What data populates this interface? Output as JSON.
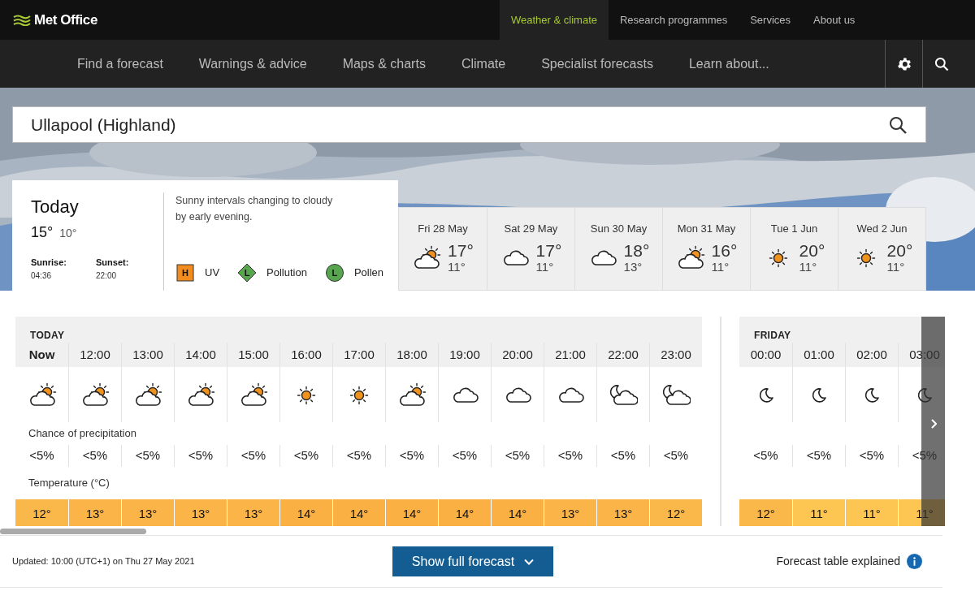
{
  "header": {
    "logo": "Met Office",
    "top_nav": [
      {
        "label": "Weather & climate",
        "selected": true
      },
      {
        "label": "Research programmes",
        "selected": false
      },
      {
        "label": "Services",
        "selected": false
      },
      {
        "label": "About us",
        "selected": false
      }
    ],
    "main_nav": [
      "Find a forecast",
      "Warnings & advice",
      "Maps & charts",
      "Climate",
      "Specialist forecasts",
      "Learn about..."
    ]
  },
  "search": {
    "value": "Ullapool (Highland)"
  },
  "today": {
    "title": "Today",
    "high": "15°",
    "low": "10°",
    "sunrise_label": "Sunrise:",
    "sunrise": "04:36",
    "sunset_label": "Sunset:",
    "sunset": "22:00",
    "summary": "Sunny intervals changing to cloudy by early evening.",
    "indices": [
      {
        "kind": "square",
        "letter": "H",
        "label": "UV",
        "color": "#f28c1e"
      },
      {
        "kind": "diamond",
        "letter": "L",
        "label": "Pollution",
        "color": "#57a64f"
      },
      {
        "kind": "circle",
        "letter": "L",
        "label": "Pollen",
        "color": "#57a64f"
      }
    ]
  },
  "days": [
    {
      "date": "Fri 28 May",
      "kind": "sunny-intervals",
      "high": "17°",
      "low": "11°"
    },
    {
      "date": "Sat 29 May",
      "kind": "cloudy",
      "high": "17°",
      "low": "11°"
    },
    {
      "date": "Sun 30 May",
      "kind": "cloudy",
      "high": "18°",
      "low": "13°"
    },
    {
      "date": "Mon 31 May",
      "kind": "sunny-intervals",
      "high": "16°",
      "low": "11°"
    },
    {
      "date": "Tue 1 Jun",
      "kind": "sunny",
      "high": "20°",
      "low": "11°"
    },
    {
      "date": "Wed 2 Jun",
      "kind": "sunny",
      "high": "20°",
      "low": "11°"
    }
  ],
  "hourly": [
    {
      "day": "TODAY",
      "precip_label": "Chance of precipitation",
      "temp_label": "Temperature (°C)",
      "hours": [
        {
          "time": "Now",
          "current": true,
          "kind": "sunny-intervals",
          "precip": "<5%",
          "temp": "12°",
          "color": "#fbb84a"
        },
        {
          "time": "12:00",
          "current": false,
          "kind": "sunny-intervals",
          "precip": "<5%",
          "temp": "13°",
          "color": "#fbb447"
        },
        {
          "time": "13:00",
          "current": false,
          "kind": "sunny-intervals",
          "precip": "<5%",
          "temp": "13°",
          "color": "#fbb447"
        },
        {
          "time": "14:00",
          "current": false,
          "kind": "sunny-intervals",
          "precip": "<5%",
          "temp": "13°",
          "color": "#fbb447"
        },
        {
          "time": "15:00",
          "current": false,
          "kind": "sunny-intervals",
          "precip": "<5%",
          "temp": "13°",
          "color": "#fbb447"
        },
        {
          "time": "16:00",
          "current": false,
          "kind": "sunny",
          "precip": "<5%",
          "temp": "14°",
          "color": "#fab043"
        },
        {
          "time": "17:00",
          "current": false,
          "kind": "sunny",
          "precip": "<5%",
          "temp": "14°",
          "color": "#fab043"
        },
        {
          "time": "18:00",
          "current": false,
          "kind": "sunny-intervals",
          "precip": "<5%",
          "temp": "14°",
          "color": "#fab043"
        },
        {
          "time": "19:00",
          "current": false,
          "kind": "cloudy",
          "precip": "<5%",
          "temp": "14°",
          "color": "#fab043"
        },
        {
          "time": "20:00",
          "current": false,
          "kind": "cloudy",
          "precip": "<5%",
          "temp": "14°",
          "color": "#fab043"
        },
        {
          "time": "21:00",
          "current": false,
          "kind": "cloudy",
          "precip": "<5%",
          "temp": "13°",
          "color": "#fbb447"
        },
        {
          "time": "22:00",
          "current": false,
          "kind": "partly-cloudy-night",
          "precip": "<5%",
          "temp": "13°",
          "color": "#fbb447"
        },
        {
          "time": "23:00",
          "current": false,
          "kind": "partly-cloudy-night",
          "precip": "<5%",
          "temp": "12°",
          "color": "#fbb84a"
        }
      ]
    },
    {
      "day": "FRIDAY",
      "hours": [
        {
          "time": "00:00",
          "current": false,
          "kind": "clear-night",
          "precip": "<5%",
          "temp": "12°",
          "color": "#fbb84a"
        },
        {
          "time": "01:00",
          "current": false,
          "kind": "clear-night",
          "precip": "<5%",
          "temp": "11°",
          "color": "#fdc552"
        },
        {
          "time": "02:00",
          "current": false,
          "kind": "clear-night",
          "precip": "<5%",
          "temp": "11°",
          "color": "#fdc552"
        },
        {
          "time": "03:00",
          "current": false,
          "kind": "clear-night",
          "precip": "<5%",
          "temp": "11°",
          "color": "#fdc552"
        }
      ]
    }
  ],
  "footer": {
    "updated": "Updated: 10:00 (UTC+1) on Thu 27 May 2021",
    "button": "Show full forecast",
    "link": "Forecast table explained"
  }
}
